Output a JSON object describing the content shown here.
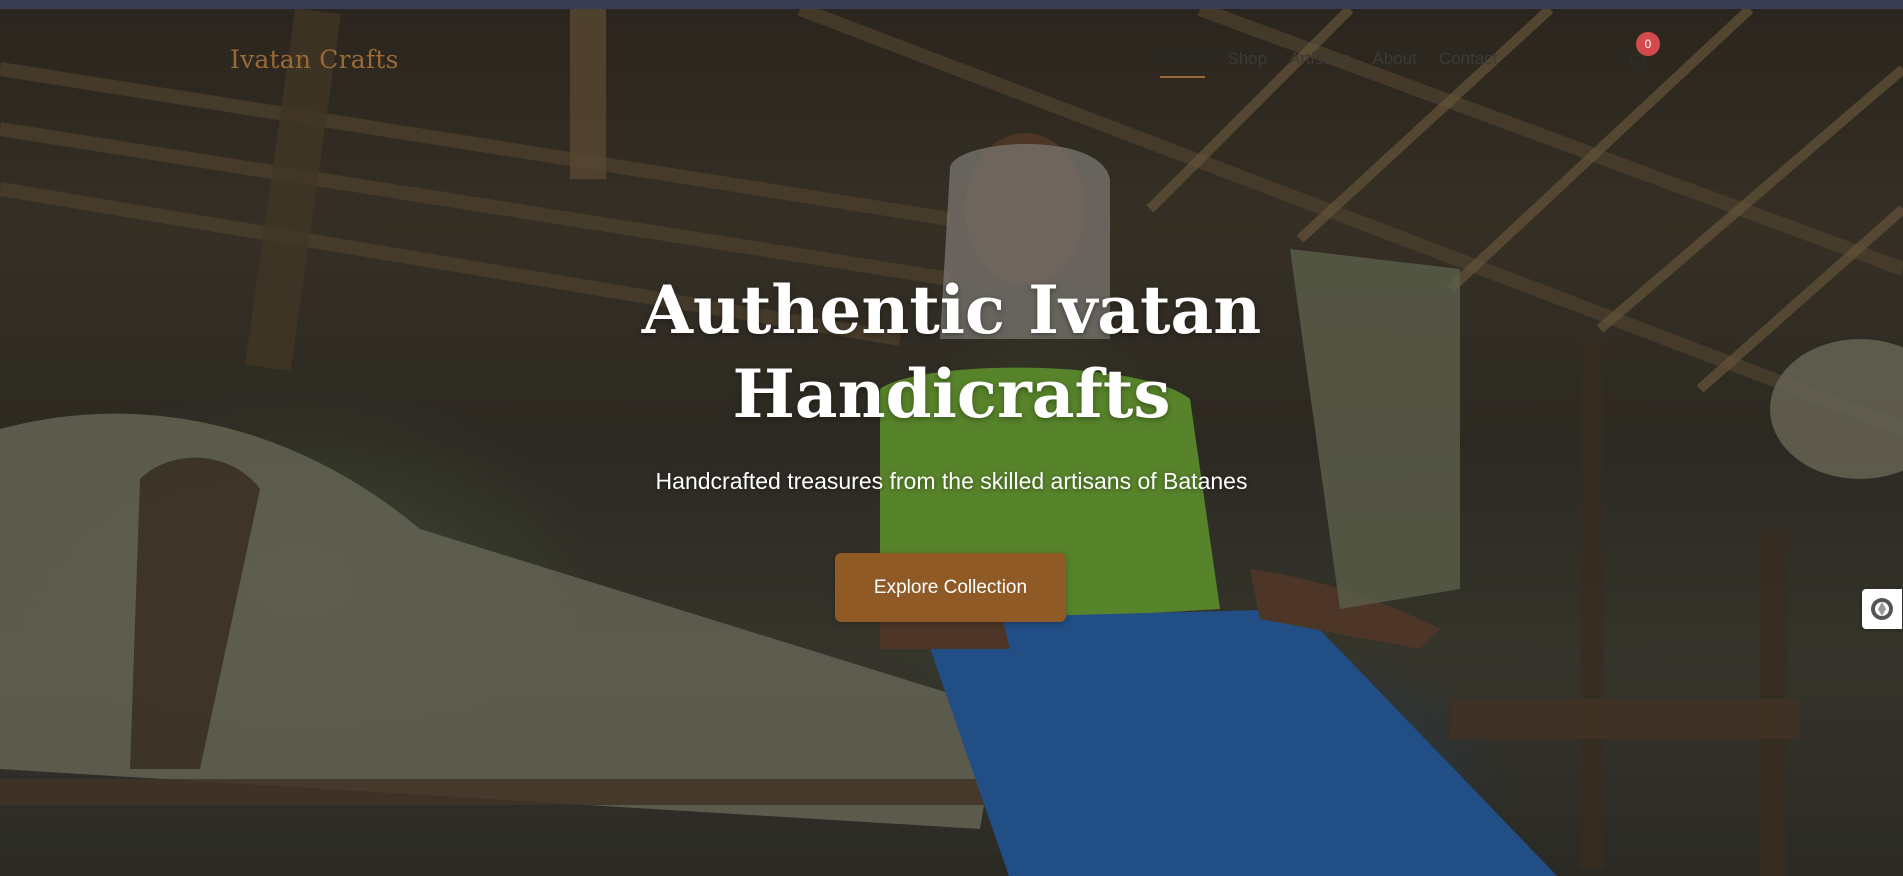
{
  "brand": {
    "logo_text": "Ivatan Crafts",
    "accent_color": "#8f5a26"
  },
  "nav": {
    "items": [
      {
        "label": "Home",
        "active": true
      },
      {
        "label": "Shop",
        "active": false
      },
      {
        "label": "Artisans",
        "active": false
      },
      {
        "label": "About",
        "active": false
      },
      {
        "label": "Contact",
        "active": false
      }
    ],
    "cart": {
      "icon": "cart-icon",
      "count": "0",
      "badge_color": "#d44a4a"
    }
  },
  "hero": {
    "title_line1": "Authentic Ivatan",
    "title_line2": "Handicrafts",
    "subtitle": "Handcrafted treasures from the skilled artisans of Batanes",
    "cta_label": "Explore Collection",
    "background": "Photo of an elderly Ivatan artisan seated under a thatched bamboo hut with bundles of dried grass fiber"
  },
  "side_widget": {
    "icon": "accessibility-icon"
  }
}
